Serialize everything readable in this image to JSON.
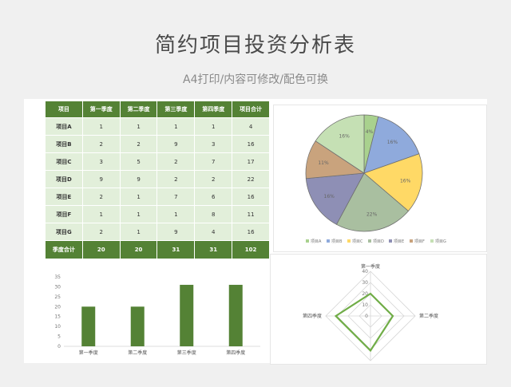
{
  "page": {
    "title": "简约项目投资分析表",
    "subtitle": "A4打印/内容可修改/配色可换"
  },
  "table": {
    "headers": [
      "项目",
      "第一季度",
      "第二季度",
      "第三季度",
      "第四季度",
      "项目合计"
    ],
    "rows": [
      [
        "项目A",
        "1",
        "1",
        "1",
        "1",
        "4"
      ],
      [
        "项目B",
        "2",
        "2",
        "9",
        "3",
        "16"
      ],
      [
        "项目C",
        "3",
        "5",
        "2",
        "7",
        "17"
      ],
      [
        "项目D",
        "9",
        "9",
        "2",
        "2",
        "22"
      ],
      [
        "项目E",
        "2",
        "1",
        "7",
        "6",
        "16"
      ],
      [
        "项目F",
        "1",
        "1",
        "1",
        "8",
        "11"
      ],
      [
        "项目G",
        "2",
        "1",
        "9",
        "4",
        "16"
      ]
    ],
    "total": [
      "季度合计",
      "20",
      "20",
      "31",
      "31",
      "102"
    ]
  },
  "colors": {
    "header": "#548235",
    "row": "#e2efda",
    "bar": "#548235"
  },
  "chart_data": [
    {
      "type": "pie",
      "categories": [
        "项目A",
        "项目B",
        "项目C",
        "项目D",
        "项目E",
        "项目F",
        "项目G"
      ],
      "values": [
        4,
        16,
        17,
        22,
        16,
        11,
        16
      ],
      "labels": [
        "4%",
        "16%",
        "16%",
        "22%",
        "16%",
        "11%",
        "16%"
      ],
      "colors": [
        "#a9d18e",
        "#8faadc",
        "#ffd966",
        "#a9bfa0",
        "#8e8fb5",
        "#c9a37d",
        "#c5e0b4"
      ],
      "legend": "bottom"
    },
    {
      "type": "bar",
      "categories": [
        "第一季度",
        "第二季度",
        "第三季度",
        "第四季度"
      ],
      "values": [
        20,
        20,
        31,
        31
      ],
      "ylim": [
        0,
        35
      ],
      "yticks": [
        "0",
        "5",
        "10",
        "15",
        "20",
        "25",
        "30",
        "35"
      ]
    },
    {
      "type": "radar",
      "categories": [
        "第一季度",
        "第二季度",
        "第三季度",
        "第四季度"
      ],
      "values": [
        20,
        20,
        31,
        31
      ],
      "rlim": [
        0,
        40
      ],
      "rticks": [
        "0",
        "10",
        "20",
        "30",
        "40"
      ]
    }
  ]
}
